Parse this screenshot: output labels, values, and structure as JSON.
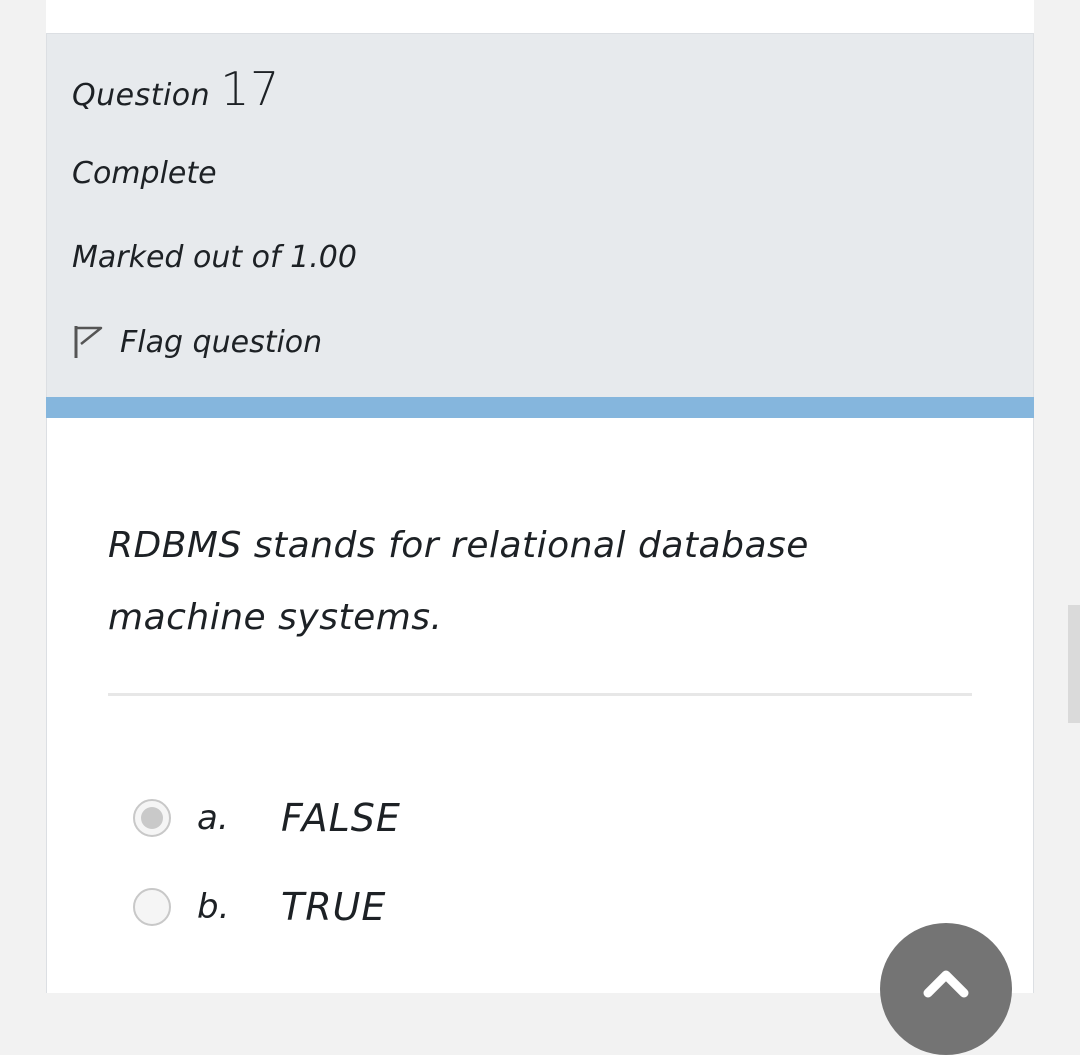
{
  "question_info": {
    "label": "Question",
    "number": "17",
    "state": "Complete",
    "grade": "Marked out of 1.00",
    "flag_label": "Flag question",
    "flag_icon": "flag-icon"
  },
  "question": {
    "text": "RDBMS stands for relational database machine systems."
  },
  "answers": [
    {
      "letter": "a.",
      "text": "FALSE",
      "selected": true
    },
    {
      "letter": "b.",
      "text": "TRUE",
      "selected": false
    }
  ],
  "colors": {
    "info_bg": "#e7eaed",
    "accent_bar": "#85b6dd",
    "back_to_top": "#747474"
  },
  "back_to_top_icon": "chevron-up-icon"
}
